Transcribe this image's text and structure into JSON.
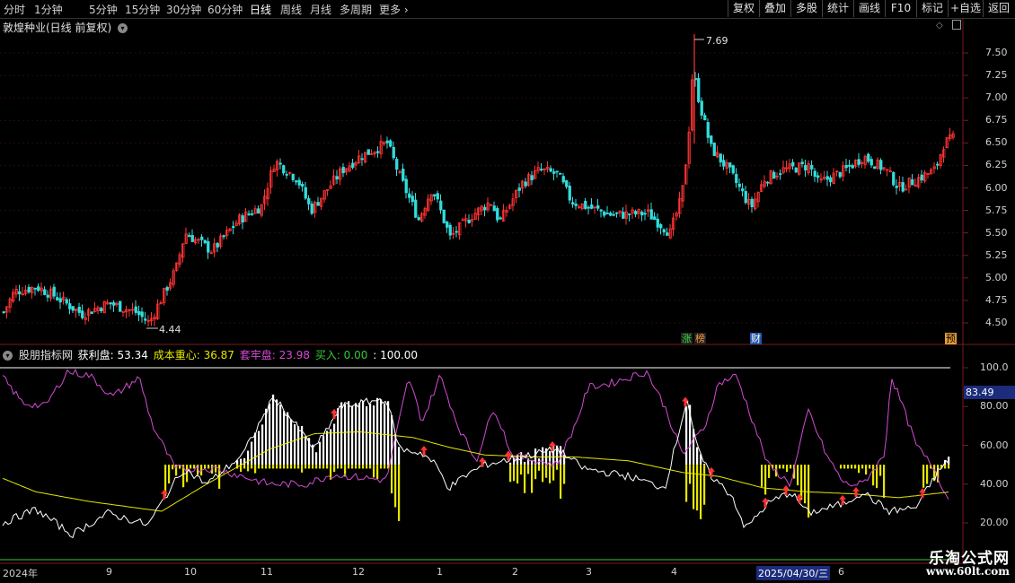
{
  "toolbar": {
    "periods": [
      "分时",
      "1分钟",
      "5分钟",
      "15分钟",
      "30分钟",
      "60分钟",
      "日线",
      "周线",
      "月线",
      "多周期",
      "更多"
    ],
    "active_period": "日线",
    "buttons": [
      "复权",
      "叠加",
      "多股",
      "统计",
      "画线",
      "F10",
      "标记",
      "+自选",
      "返回"
    ]
  },
  "main_chart": {
    "title": "敦煌种业(日线 前复权)",
    "y_ticks": [
      "7.50",
      "7.25",
      "7.00",
      "6.75",
      "6.50",
      "6.25",
      "6.00",
      "5.75",
      "5.50",
      "5.25",
      "5.00",
      "4.75",
      "4.50"
    ],
    "high_label": "7.69",
    "low_label": "4.44",
    "tags": [
      "涨",
      "榜",
      "财",
      "预"
    ]
  },
  "indicator": {
    "name": "股朋指标网",
    "items": [
      {
        "label": "获利盘: 53.34",
        "color": "#ffffff"
      },
      {
        "label": "成本重心: 36.87",
        "color": "#e6e600"
      },
      {
        "label": "套牢盘: 23.98",
        "color": "#d44bd4"
      },
      {
        "label": "买入: 0.00",
        "color": "#33cc33"
      },
      {
        "label": ": 100.00",
        "color": "#ffffff"
      }
    ],
    "y_ticks": [
      "100.0",
      "80.00",
      "60.00",
      "40.00",
      "20.00"
    ],
    "current_value": "83.49"
  },
  "date_axis": {
    "labels": [
      "2024年",
      "9",
      "10",
      "11",
      "12",
      "1",
      "2",
      "3",
      "4",
      "2025/04/30/三",
      "6"
    ]
  },
  "watermark": {
    "line1": "乐淘公式网",
    "line2": "www.60lt.com"
  },
  "colors": {
    "up": "#ff3333",
    "down": "#33dddd",
    "profit": "#ffffff",
    "cost": "#e6e600",
    "trapped": "#d44bd4",
    "buy": "#33cc33"
  }
}
